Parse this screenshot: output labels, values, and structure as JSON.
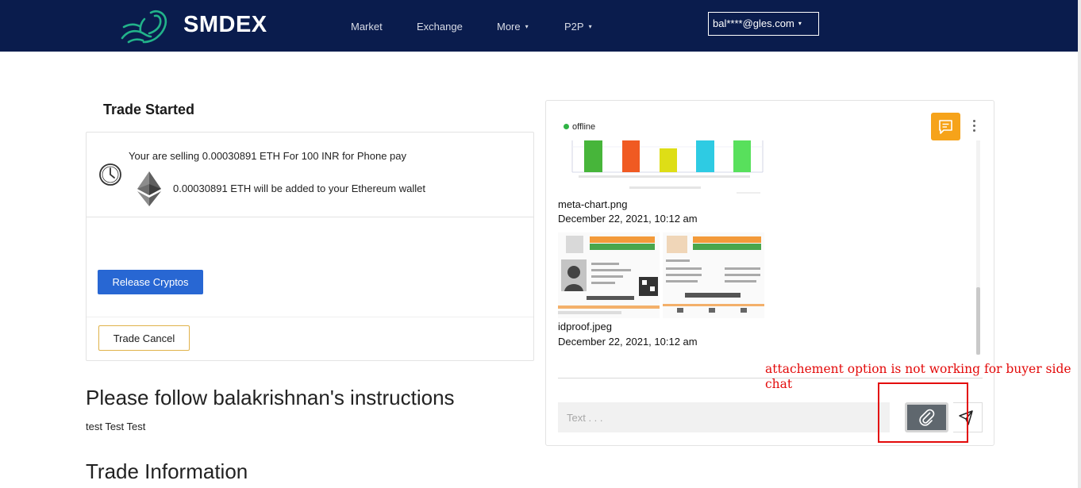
{
  "header": {
    "brand": "SMDEX",
    "logo_icon": "leaping-lion-logo",
    "nav": [
      {
        "label": "Market",
        "has_dropdown": false
      },
      {
        "label": "Exchange",
        "has_dropdown": false
      },
      {
        "label": "More",
        "has_dropdown": true
      },
      {
        "label": "P2P",
        "has_dropdown": true
      }
    ],
    "user_email": "bal****@gles.com",
    "dropdown_caret": "⌄",
    "bg_color": "#0a1c4d"
  },
  "trade": {
    "title": "Trade Started",
    "sell_text": "Your are selling 0.00030891 ETH For 100 INR for Phone pay",
    "wallet_text": "0.00030891 ETH will be added to your Ethereum wallet",
    "release_button": "Release Cryptos",
    "cancel_button": "Trade Cancel"
  },
  "instructions": {
    "title": "Please follow balakrishnan's instructions",
    "text": "test Test Test"
  },
  "trade_info": {
    "title": "Trade Information"
  },
  "chat": {
    "status": "offline",
    "messages": [
      {
        "file_name": "meta-chart.png",
        "date": "December 22, 2021, 10:12 am"
      },
      {
        "file_name": "idproof.jpeg",
        "date": "December 22, 2021, 10:12 am"
      }
    ],
    "input_placeholder": "Text . . .",
    "accent_color": "#f6a31a"
  },
  "annotation": {
    "text": "attachement option is not working for buyer side chat",
    "color": "#e30a0a"
  }
}
